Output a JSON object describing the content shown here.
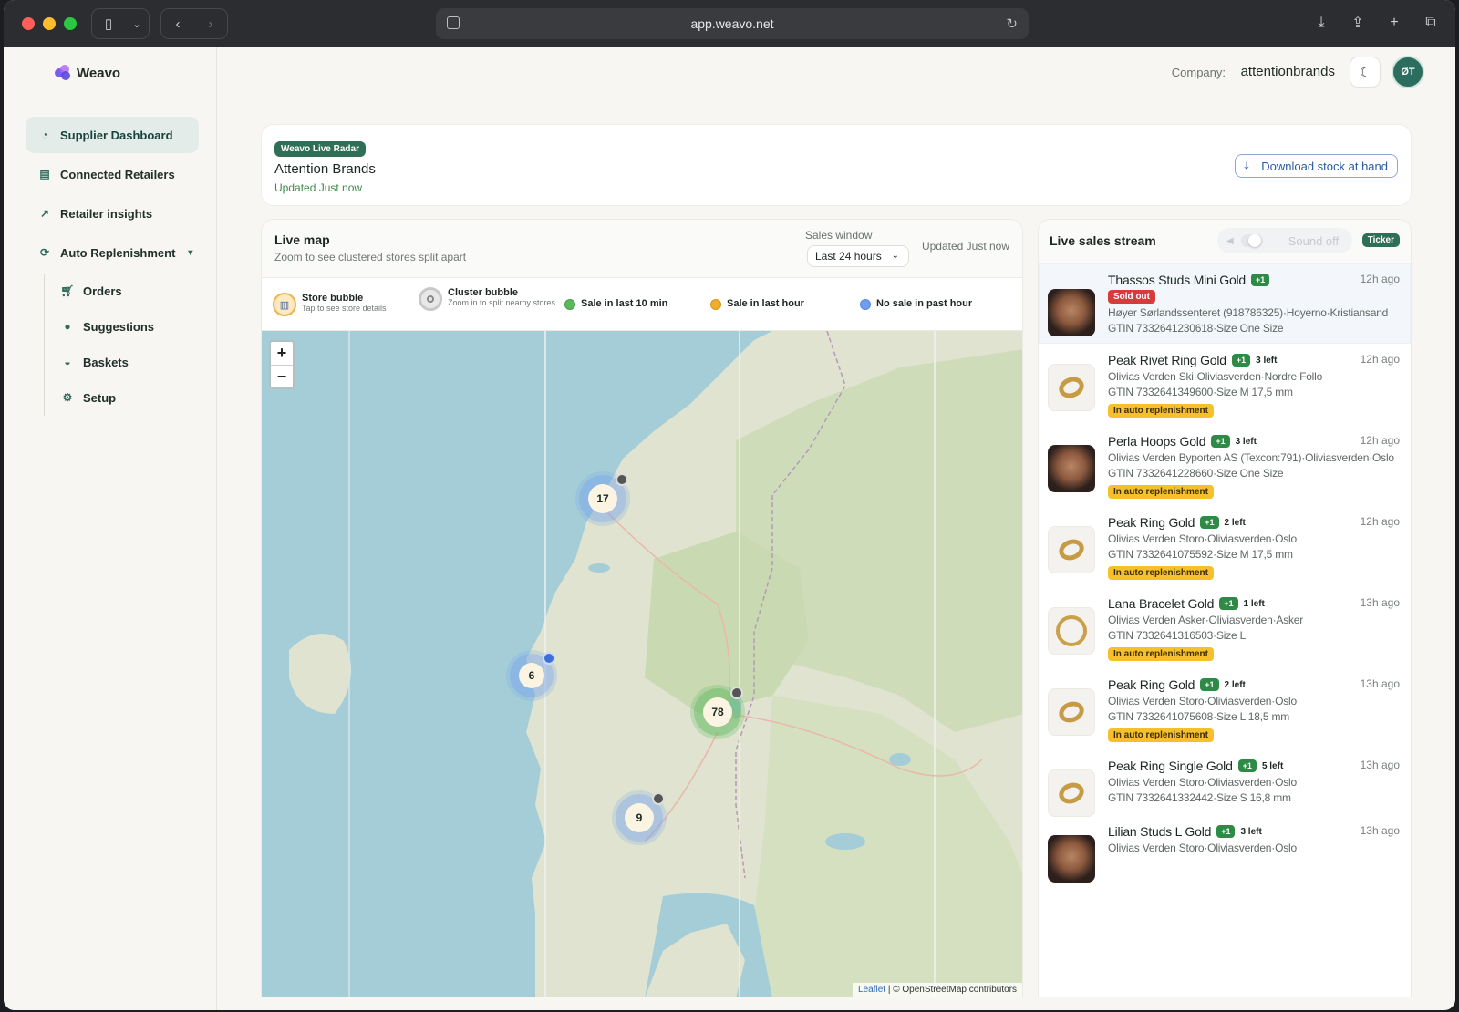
{
  "browser": {
    "url": "app.weavo.net"
  },
  "sidebar": {
    "brand": "Weavo",
    "items": [
      {
        "label": "Supplier Dashboard",
        "icon": "gauge-icon"
      },
      {
        "label": "Connected Retailers",
        "icon": "store-icon"
      },
      {
        "label": "Retailer insights",
        "icon": "chart-line-icon"
      },
      {
        "label": "Auto Replenishment",
        "icon": "refresh-icon"
      }
    ],
    "subitems": [
      {
        "label": "Orders",
        "icon": "cart-icon"
      },
      {
        "label": "Suggestions",
        "icon": "lightbulb-icon"
      },
      {
        "label": "Baskets",
        "icon": "basket-icon"
      },
      {
        "label": "Setup",
        "icon": "gear-icon"
      }
    ]
  },
  "topbar": {
    "company_label": "Company:",
    "company_name": "attentionbrands",
    "avatar_initials": "ØT"
  },
  "header_card": {
    "badge": "Weavo Live Radar",
    "title": "Attention Brands",
    "updated": "Updated Just now",
    "download_label": "Download stock at hand"
  },
  "live_map": {
    "title": "Live map",
    "subtitle": "Zoom to see clustered stores split apart",
    "sales_window_label": "Sales window",
    "sales_window_value": "Last 24 hours",
    "updated": "Updated Just now",
    "legend": {
      "store_title": "Store bubble",
      "store_desc": "Tap to see store details",
      "cluster_title": "Cluster bubble",
      "cluster_desc": "Zoom in to split nearby stores",
      "last10": "Sale in last 10 min",
      "last_hour": "Sale in last hour",
      "no_sale": "No sale in past hour"
    },
    "clusters": [
      {
        "count": "17"
      },
      {
        "count": "6"
      },
      {
        "count": "78"
      },
      {
        "count": "9"
      }
    ],
    "attribution_link": "Leaflet",
    "attribution_text": " | © OpenStreetMap contributors",
    "colors": {
      "last10": "#5cb85c",
      "last_hour": "#f0ad2c",
      "no_sale": "#6f9ef0"
    }
  },
  "stream": {
    "title": "Live sales stream",
    "sound_label": "Sound off",
    "ticker": "Ticker",
    "sales": [
      {
        "name": "Thassos Studs Mini Gold",
        "qty": "+1",
        "left": "",
        "status": "Sold out",
        "store": "Høyer Sørlandssenteret (918786325)·Hoyerno·Kristiansand",
        "gtin": "GTIN 7332641230618·Size One Size",
        "time": "12h ago",
        "thumb": "face"
      },
      {
        "name": "Peak Rivet Ring Gold",
        "qty": "+1",
        "left": "3 left",
        "status": "In auto replenishment",
        "store": "Olivias Verden Ski·Oliviasverden·Nordre Follo",
        "gtin": "GTIN 7332641349600·Size M 17,5 mm",
        "time": "12h ago",
        "thumb": "ring"
      },
      {
        "name": "Perla Hoops Gold",
        "qty": "+1",
        "left": "3 left",
        "status": "In auto replenishment",
        "store": "Olivias Verden Byporten AS (Texcon:791)·Oliviasverden·Oslo",
        "gtin": "GTIN 7332641228660·Size One Size",
        "time": "12h ago",
        "thumb": "face"
      },
      {
        "name": "Peak Ring Gold",
        "qty": "+1",
        "left": "2 left",
        "status": "In auto replenishment",
        "store": "Olivias Verden Storo·Oliviasverden·Oslo",
        "gtin": "GTIN 7332641075592·Size M 17,5 mm",
        "time": "12h ago",
        "thumb": "ring"
      },
      {
        "name": "Lana Bracelet Gold",
        "qty": "+1",
        "left": "1 left",
        "status": "In auto replenishment",
        "store": "Olivias Verden Asker·Oliviasverden·Asker",
        "gtin": "GTIN 7332641316503·Size L",
        "time": "13h ago",
        "thumb": "bracelet"
      },
      {
        "name": "Peak Ring Gold",
        "qty": "+1",
        "left": "2 left",
        "status": "In auto replenishment",
        "store": "Olivias Verden Storo·Oliviasverden·Oslo",
        "gtin": "GTIN 7332641075608·Size L 18,5 mm",
        "time": "13h ago",
        "thumb": "ring"
      },
      {
        "name": "Peak Ring Single Gold",
        "qty": "+1",
        "left": "5 left",
        "status": "",
        "store": "Olivias Verden Storo·Oliviasverden·Oslo",
        "gtin": "GTIN 7332641332442·Size S 16,8 mm",
        "time": "13h ago",
        "thumb": "ring"
      },
      {
        "name": "Lilian Studs L Gold",
        "qty": "+1",
        "left": "3 left",
        "status": "",
        "store": "Olivias Verden Storo·Oliviasverden·Oslo",
        "gtin": "",
        "time": "13h ago",
        "thumb": "face"
      }
    ]
  }
}
